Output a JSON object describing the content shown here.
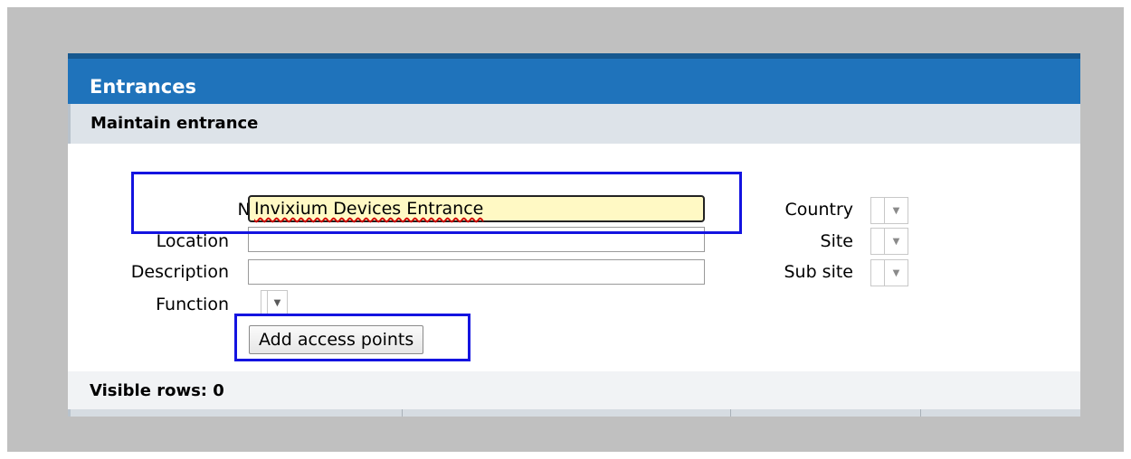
{
  "panel": {
    "title": "Entrances",
    "section_title": "Maintain entrance"
  },
  "form": {
    "name_label": "Name*",
    "name_value": "Invixium Devices Entrance",
    "location_label": "Location",
    "location_value": "",
    "description_label": "Description",
    "description_value": "",
    "function_label": "Function",
    "add_access_points_label": "Add access points",
    "country_label": "Country",
    "site_label": "Site",
    "sub_site_label": "Sub site"
  },
  "grid": {
    "visible_rows_text": "Visible rows: 0"
  },
  "icons": {
    "dropdown_arrow": "chevron-down-icon"
  },
  "colors": {
    "title_bar": "#1f73bb",
    "section_bar": "#dde3e9",
    "focused_input": "#fff9c4",
    "annotation_box": "#1414e0"
  }
}
